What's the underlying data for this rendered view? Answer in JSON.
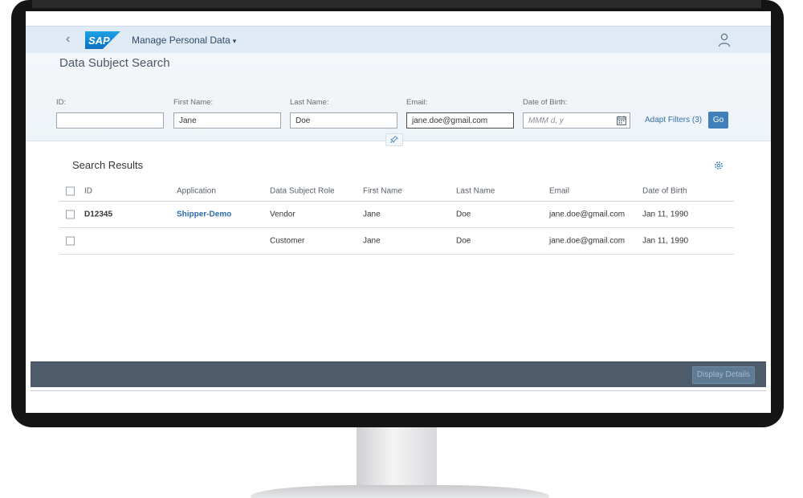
{
  "shell": {
    "back_glyph": "‹",
    "logo_text": "SAP",
    "app_title": "Manage Personal Data",
    "caret": "▾"
  },
  "page": {
    "title": "Data Subject Search"
  },
  "filters": {
    "id": {
      "label": "ID:",
      "value": ""
    },
    "first_name": {
      "label": "First Name:",
      "value": "Jane"
    },
    "last_name": {
      "label": "Last Name:",
      "value": "Doe"
    },
    "email": {
      "label": "Email:",
      "value": "jane.doe@gmail.com"
    },
    "dob": {
      "label": "Date of Birth:",
      "placeholder": "MMM d, y"
    },
    "adapt_label": "Adapt Filters (3)",
    "go_label": "Go"
  },
  "results": {
    "title": "Search Results",
    "columns": [
      "ID",
      "Application",
      "Data Subject Role",
      "First Name",
      "Last Name",
      "Email",
      "Date of Birth"
    ],
    "rows": [
      {
        "id": "D12345",
        "application": "Shipper-Demo",
        "role": "Vendor",
        "first": "Jane",
        "last": "Doe",
        "email": "jane.doe@gmail.com",
        "dob": "Jan 11, 1990"
      },
      {
        "id": "",
        "application": "",
        "role": "Customer",
        "first": "Jane",
        "last": "Doe",
        "email": "jane.doe@gmail.com",
        "dob": "Jan 11, 1990"
      }
    ]
  },
  "footer": {
    "display_details_label": "Display Details"
  },
  "colors": {
    "shell_bg": "#dfeaf5",
    "accent": "#3f7fba",
    "link": "#2d6bab",
    "footer_bg": "#4d5b6a"
  },
  "icons": [
    "back-icon",
    "sap-logo",
    "user-icon",
    "calendar-icon",
    "pin-icon",
    "settings-icon"
  ]
}
